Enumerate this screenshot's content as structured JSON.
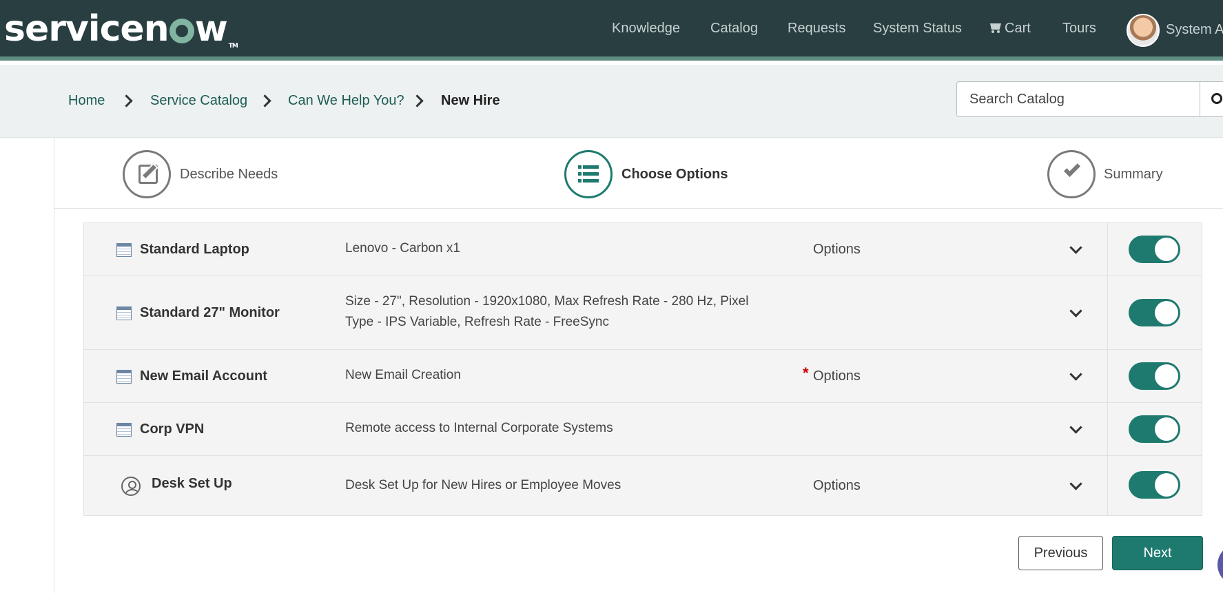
{
  "header": {
    "logo": "servicenow",
    "nav": [
      {
        "label": "Knowledge"
      },
      {
        "label": "Catalog"
      },
      {
        "label": "Requests"
      },
      {
        "label": "System Status"
      },
      {
        "label": "Cart",
        "icon": "cart-icon"
      },
      {
        "label": "Tours"
      }
    ],
    "user_name": "System Ad"
  },
  "breadcrumb": {
    "items": [
      "Home",
      "Service Catalog",
      "Can We Help You?"
    ],
    "current": "New Hire"
  },
  "search": {
    "placeholder": "Search Catalog",
    "value": ""
  },
  "steps": [
    {
      "label": "Describe Needs",
      "icon": "pencil-icon",
      "active": false
    },
    {
      "label": "Choose Options",
      "icon": "list-icon",
      "active": true
    },
    {
      "label": "Summary",
      "icon": "check-icon",
      "active": false
    }
  ],
  "items": [
    {
      "name": "Standard Laptop",
      "description": "Lenovo - Carbon x1",
      "options": "Options",
      "required": false,
      "icon": "catalog-item-icon",
      "enabled": true
    },
    {
      "name": "Standard 27\" Monitor",
      "description": "Size - 27\", Resolution - 1920x1080, Max Refresh Rate - 280 Hz, Pixel Type - IPS Variable, Refresh Rate - FreeSync",
      "options": "",
      "required": false,
      "icon": "catalog-item-icon",
      "enabled": true
    },
    {
      "name": "New Email Account",
      "description": "New Email Creation",
      "options": "Options",
      "required": true,
      "required_mark": "*",
      "icon": "catalog-item-icon",
      "enabled": true
    },
    {
      "name": "Corp VPN",
      "description": "Remote access to Internal Corporate Systems",
      "options": "",
      "required": false,
      "icon": "catalog-item-icon",
      "enabled": true
    },
    {
      "name": "Desk Set Up",
      "description": "Desk Set Up for New Hires or Employee Moves",
      "options": "Options",
      "required": false,
      "icon": "person-icon",
      "enabled": true
    }
  ],
  "buttons": {
    "previous": "Previous",
    "next": "Next"
  },
  "colors": {
    "header_bg": "#293e40",
    "accent": "#1e7a6e",
    "crumb_bg": "#edf1f2"
  }
}
